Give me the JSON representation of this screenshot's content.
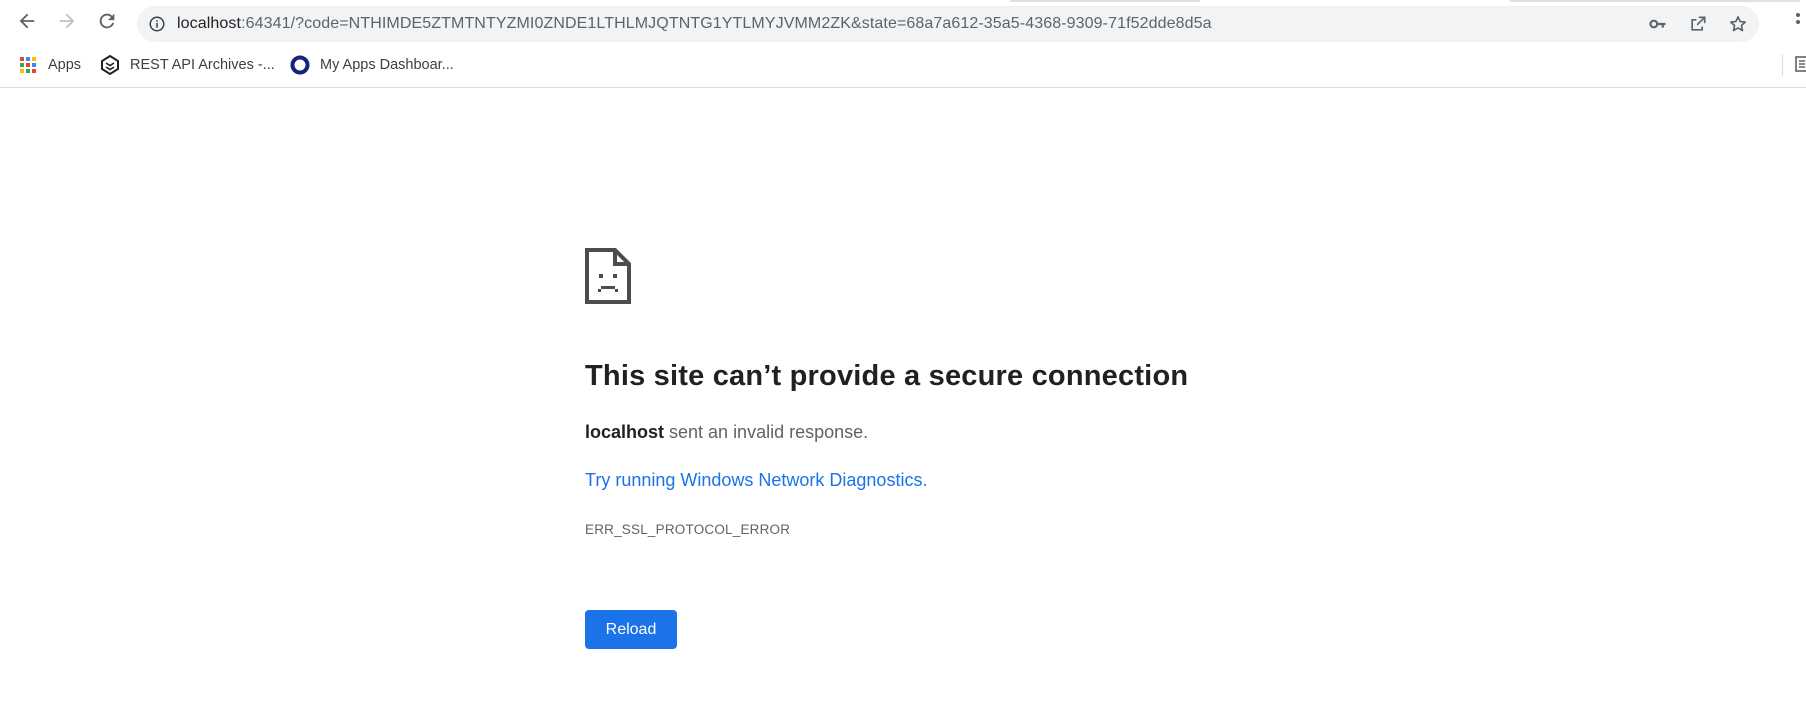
{
  "browser": {
    "url_host": "localhost",
    "url_rest": ":64341/?code=NTHIMDE5ZTMTNTYZMI0ZNDE1LTHLMJQTNTG1YTLMYJVMM2ZK&state=68a7a612-35a5-4368-9309-71f52dde8d5a",
    "icons": {
      "back": "back-arrow-icon",
      "forward": "forward-arrow-icon",
      "reload": "reload-icon",
      "site_info": "info-icon",
      "password": "key-icon",
      "share": "share-icon",
      "bookmark": "star-icon",
      "menu": "kebab-menu-icon"
    }
  },
  "bookmarks": [
    {
      "label": "Apps",
      "icon": "apps-grid-icon"
    },
    {
      "label": "REST API Archives -...",
      "icon": "site-favicon-icon"
    },
    {
      "label": "My Apps Dashboar...",
      "icon": "circle-favicon-icon"
    }
  ],
  "error": {
    "icon": "sad-page-icon",
    "title": "This site can’t provide a secure connection",
    "host": "localhost",
    "desc_rest": " sent an invalid response.",
    "suggest_link": "Try running Windows Network Diagnostics",
    "suggest_end": ".",
    "code": "ERR_SSL_PROTOCOL_ERROR",
    "reload_label": "Reload"
  },
  "colors": {
    "accent": "#1a73e8",
    "text": "#202124",
    "secondary_text": "#5f6368",
    "omnibox_bg": "#f1f3f4"
  }
}
